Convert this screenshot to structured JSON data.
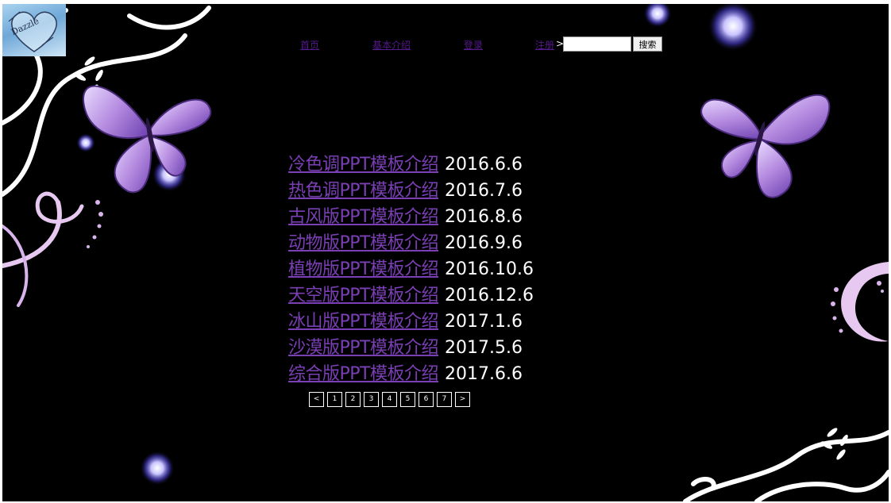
{
  "logo": {
    "text": "Dazzle"
  },
  "nav": {
    "items": [
      {
        "label": "首页"
      },
      {
        "label": "基本介绍"
      },
      {
        "label": "登录"
      },
      {
        "label": "注册"
      }
    ],
    "separator": ">",
    "search_value": "",
    "search_button": "搜索"
  },
  "articles": [
    {
      "title": "冷色调PPT模板介绍",
      "date": "2016.6.6"
    },
    {
      "title": "热色调PPT模板介绍",
      "date": "2016.7.6"
    },
    {
      "title": "古风版PPT模板介绍",
      "date": "2016.8.6"
    },
    {
      "title": "动物版PPT模板介绍",
      "date": "2016.9.6"
    },
    {
      "title": "植物版PPT模板介绍",
      "date": "2016.10.6"
    },
    {
      "title": "天空版PPT模板介绍",
      "date": "2016.12.6"
    },
    {
      "title": "冰山版PPT模板介绍",
      "date": "2017.1.6"
    },
    {
      "title": "沙漠版PPT模板介绍",
      "date": "2017.5.6"
    },
    {
      "title": "综合版PPT模板介绍",
      "date": "2017.6.6"
    }
  ],
  "pagination": {
    "prev": "<",
    "pages": [
      "1",
      "2",
      "3",
      "4",
      "5",
      "6",
      "7"
    ],
    "next": ">"
  },
  "colors": {
    "background": "#000000",
    "link": "#7b3fb5",
    "nav_link": "#551a8b",
    "date_text": "#ffffff",
    "butterfly": "#b58be0"
  }
}
